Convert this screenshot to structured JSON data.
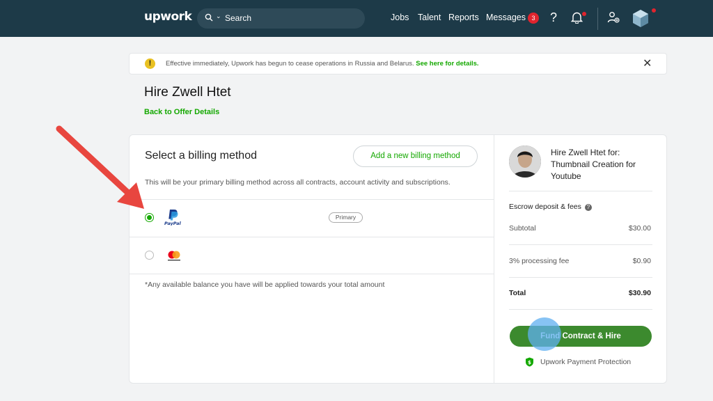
{
  "nav": {
    "logo": "upwork",
    "search_placeholder": "Search",
    "links": [
      "Jobs",
      "Talent",
      "Reports",
      "Messages"
    ],
    "messages_badge": "3",
    "help": "?"
  },
  "notice": {
    "text": "Effective immediately, Upwork has begun to cease operations in Russia and Belarus.",
    "link": "See here for details.",
    "close": "✕"
  },
  "page": {
    "title": "Hire Zwell Htet",
    "back_link": "Back to Offer Details"
  },
  "billing": {
    "title": "Select a billing method",
    "add_button": "Add a new billing method",
    "subtitle": "This will be your primary billing method across all contracts, account activity and subscriptions.",
    "methods": [
      {
        "brand": "PayPal",
        "badge": "Primary",
        "selected": true
      },
      {
        "brand": "Mastercard",
        "badge": "",
        "selected": false
      }
    ],
    "footnote": "*Any available balance you have will be applied towards your total amount"
  },
  "summary": {
    "heading": "Hire Zwell Htet for: Thumbnail Creation for Youtube",
    "escrow_label": "Escrow deposit & fees",
    "subtotal_label": "Subtotal",
    "subtotal_value": "$30.00",
    "fee_label": "3% processing fee",
    "fee_value": "$0.90",
    "total_label": "Total",
    "total_value": "$30.90",
    "fund_button": "Fund Contract & Hire",
    "protection": "Upwork Payment Protection"
  },
  "colors": {
    "nav_bg": "#1d3a48",
    "accent_green": "#14a800",
    "button_green": "#3c8a2e",
    "badge_red": "#e0242e",
    "annotation_arrow": "#e8463f"
  }
}
